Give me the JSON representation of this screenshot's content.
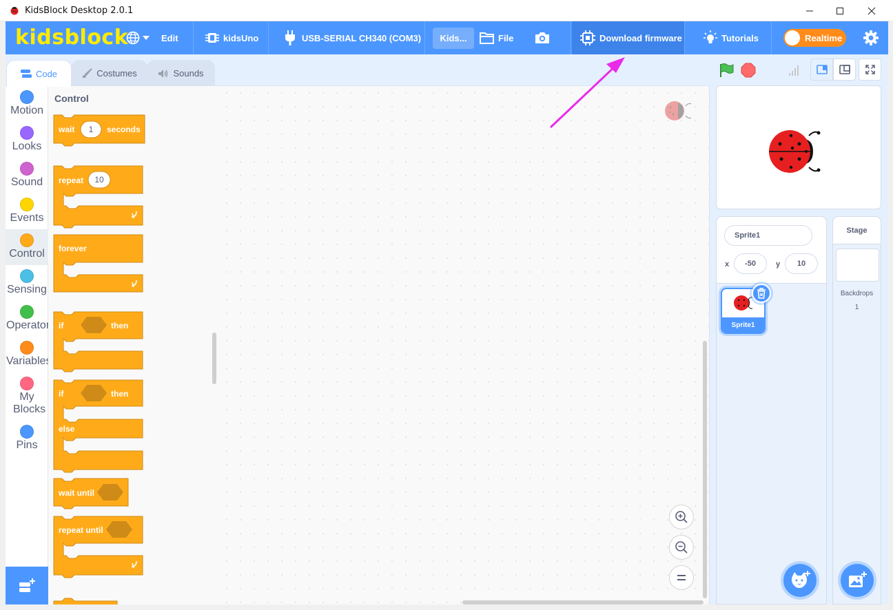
{
  "window": {
    "title": "KidsBlock Desktop 2.0.1",
    "minimize_icon": "minimize-icon",
    "maximize_icon": "maximize-icon",
    "close_icon": "close-icon"
  },
  "menubar": {
    "logo": "kidsblock",
    "language_icon": "globe-icon",
    "edit": "Edit",
    "device": "kidsUno",
    "port": "USB-SERIAL CH340 (COM3)",
    "project_title": "Kids...",
    "file": "File",
    "screenshot_icon": "camera-icon",
    "download_firmware": "Download firmware",
    "tutorials": "Tutorials",
    "realtime": "Realtime",
    "settings_icon": "gear-icon",
    "colors": {
      "bar": "#4c97ff",
      "logo": "#ffeb00",
      "realtime_toggle": "#ff8c1a"
    }
  },
  "tabs": {
    "code": "Code",
    "costumes": "Costumes",
    "sounds": "Sounds"
  },
  "categories": [
    {
      "label": "Motion",
      "color": "#4c97ff"
    },
    {
      "label": "Looks",
      "color": "#9966ff"
    },
    {
      "label": "Sound",
      "color": "#cf63cf"
    },
    {
      "label": "Events",
      "color": "#ffd500"
    },
    {
      "label": "Control",
      "color": "#ffab19"
    },
    {
      "label": "Sensing",
      "color": "#4cbfe6"
    },
    {
      "label": "Operators",
      "color": "#40bf4a"
    },
    {
      "label": "Variables",
      "color": "#ff8c1a"
    },
    {
      "label": "My Blocks",
      "color": "#ff6680"
    },
    {
      "label": "Pins",
      "color": "#4c97ff"
    }
  ],
  "palette": {
    "heading": "Control",
    "blocks": {
      "wait": "wait",
      "wait_value": "1",
      "seconds": "seconds",
      "repeat": "repeat",
      "repeat_value": "10",
      "forever": "forever",
      "if1": "if",
      "then1": "then",
      "if2": "if",
      "then2": "then",
      "else": "else",
      "wait_until": "wait until",
      "repeat_until": "repeat until"
    },
    "block_color": "#ffab19"
  },
  "stage_controls": {
    "green_flag_icon": "green-flag-icon",
    "stop_icon": "stop-icon",
    "signal_icon": "signal-icon",
    "small_stage_icon": "small-stage-icon",
    "large_stage_icon": "large-stage-icon",
    "fullscreen_icon": "fullscreen-icon"
  },
  "sprite_info": {
    "name": "Sprite1",
    "x_label": "x",
    "x": "-50",
    "y_label": "y",
    "y": "10"
  },
  "sprites": [
    {
      "name": "Sprite1"
    }
  ],
  "stage_panel": {
    "title": "Stage",
    "backdrops_label": "Backdrops",
    "backdrops_count": "1"
  },
  "zoom": {
    "zoom_in_icon": "zoom-in-icon",
    "zoom_out_icon": "zoom-out-icon",
    "reset_icon": "zoom-reset-icon"
  }
}
